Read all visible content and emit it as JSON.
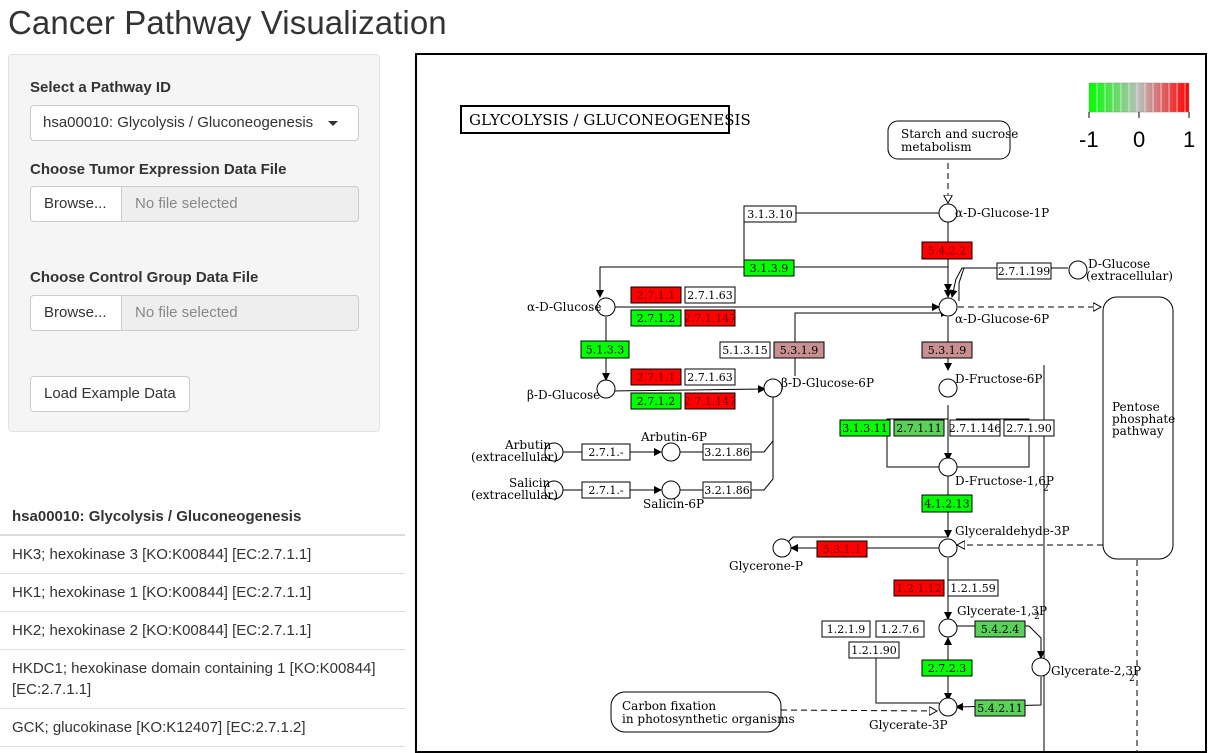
{
  "app": {
    "title": "Cancer Pathway Visualization"
  },
  "sidebar": {
    "pathway_label": "Select a Pathway ID",
    "pathway_selected": "hsa00010: Glycolysis / Gluconeogenesis",
    "tumor_label": "Choose Tumor Expression Data File",
    "control_label": "Choose Control Group Data File",
    "browse_label": "Browse...",
    "no_file": "No file selected",
    "load_button": "Load Example Data"
  },
  "gene_table": {
    "header": "hsa00010: Glycolysis / Gluconeogenesis",
    "rows": [
      "HK3; hexokinase 3 [KO:K00844] [EC:2.7.1.1]",
      "HK1; hexokinase 1 [KO:K00844] [EC:2.7.1.1]",
      "HK2; hexokinase 2 [KO:K00844] [EC:2.7.1.1]",
      "HKDC1; hexokinase domain containing 1 [KO:K00844] [EC:2.7.1.1]",
      "GCK; glucokinase [KO:K12407] [EC:2.7.1.2]"
    ]
  },
  "colors": {
    "up": "#ff0000",
    "down": "#00ff00",
    "mild_up": "#c89090",
    "mild_down": "#5ad25a",
    "neutral": "#ffffff"
  },
  "legend": {
    "min": "-1",
    "mid": "0",
    "max": "1"
  },
  "pathway": {
    "title": "GLYCOLYSIS / GLUCONEOGENESIS",
    "maps": {
      "starch": [
        "Starch and sucrose",
        "metabolism"
      ],
      "pentose": [
        "Pentose",
        "phosphate",
        "pathway"
      ],
      "carbon": [
        "Carbon fixation",
        "in photosynthetic organisms"
      ]
    },
    "compounds": {
      "a_glc1p": "α-D-Glucose-1P",
      "a_glc6p": "α-D-Glucose-6P",
      "a_glc": "α-D-Glucose",
      "b_glc": "β-D-Glucose",
      "b_glc6p": "β-D-Glucose-6P",
      "dglc": [
        "D-Glucose",
        "(extracellular)"
      ],
      "f6p": "D-Fructose-6P",
      "f16p": "D-Fructose-1,6P",
      "f16p_sub": "2",
      "arbutin": [
        "Arbutin",
        "(extracellular)"
      ],
      "arbutin6p": "Arbutin-6P",
      "salicin": [
        "Salicin",
        "(extracellular)"
      ],
      "salicin6p": "Salicin-6P",
      "g3p": "Glyceraldehyde-3P",
      "dhap": "Glycerone-P",
      "bpg": "Glycerate-1,3P",
      "bpg_sub": "2",
      "bpg23": "Glycerate-2,3P",
      "bpg23_sub": "2",
      "p3g": "Glycerate-3P"
    },
    "enzymes": [
      {
        "id": "e1",
        "label": "3.1.3.10",
        "color": "neutral"
      },
      {
        "id": "e2",
        "label": "5.4.2.2",
        "color": "up"
      },
      {
        "id": "e3",
        "label": "3.1.3.9",
        "color": "down"
      },
      {
        "id": "e4",
        "label": "2.7.1.199",
        "color": "neutral"
      },
      {
        "id": "e5",
        "label": "2.7.1.1",
        "color": "up"
      },
      {
        "id": "e6",
        "label": "2.7.1.63",
        "color": "neutral"
      },
      {
        "id": "e7",
        "label": "2.7.1.2",
        "color": "down"
      },
      {
        "id": "e8",
        "label": "2.7.1.147",
        "color": "up"
      },
      {
        "id": "e9",
        "label": "5.1.3.3",
        "color": "down"
      },
      {
        "id": "e10",
        "label": "5.1.3.15",
        "color": "neutral"
      },
      {
        "id": "e11",
        "label": "5.3.1.9",
        "color": "mild_up"
      },
      {
        "id": "e12",
        "label": "5.3.1.9",
        "color": "mild_up"
      },
      {
        "id": "e13",
        "label": "2.7.1.1",
        "color": "up"
      },
      {
        "id": "e14",
        "label": "2.7.1.63",
        "color": "neutral"
      },
      {
        "id": "e15",
        "label": "2.7.1.2",
        "color": "down"
      },
      {
        "id": "e16",
        "label": "2.7.1.147",
        "color": "up"
      },
      {
        "id": "e17",
        "label": "3.1.3.11",
        "color": "down"
      },
      {
        "id": "e18",
        "label": "2.7.1.11",
        "color": "mild_down"
      },
      {
        "id": "e19",
        "label": "2.7.1.146",
        "color": "neutral"
      },
      {
        "id": "e20",
        "label": "2.7.1.90",
        "color": "neutral"
      },
      {
        "id": "e21",
        "label": "2.7.1.-",
        "color": "neutral"
      },
      {
        "id": "e22",
        "label": "3.2.1.86",
        "color": "neutral"
      },
      {
        "id": "e23",
        "label": "2.7.1.-",
        "color": "neutral"
      },
      {
        "id": "e24",
        "label": "3.2.1.86",
        "color": "neutral"
      },
      {
        "id": "e25",
        "label": "4.1.2.13",
        "color": "down"
      },
      {
        "id": "e26",
        "label": "5.3.1.1",
        "color": "up"
      },
      {
        "id": "e27",
        "label": "1.2.1.12",
        "color": "up"
      },
      {
        "id": "e28",
        "label": "1.2.1.59",
        "color": "neutral"
      },
      {
        "id": "e29",
        "label": "1.2.1.9",
        "color": "neutral"
      },
      {
        "id": "e30",
        "label": "1.2.7.6",
        "color": "neutral"
      },
      {
        "id": "e31",
        "label": "5.4.2.4",
        "color": "mild_down"
      },
      {
        "id": "e32",
        "label": "1.2.1.90",
        "color": "neutral"
      },
      {
        "id": "e33",
        "label": "2.7.2.3",
        "color": "down"
      },
      {
        "id": "e34",
        "label": "5.4.2.11",
        "color": "mild_down"
      }
    ]
  }
}
